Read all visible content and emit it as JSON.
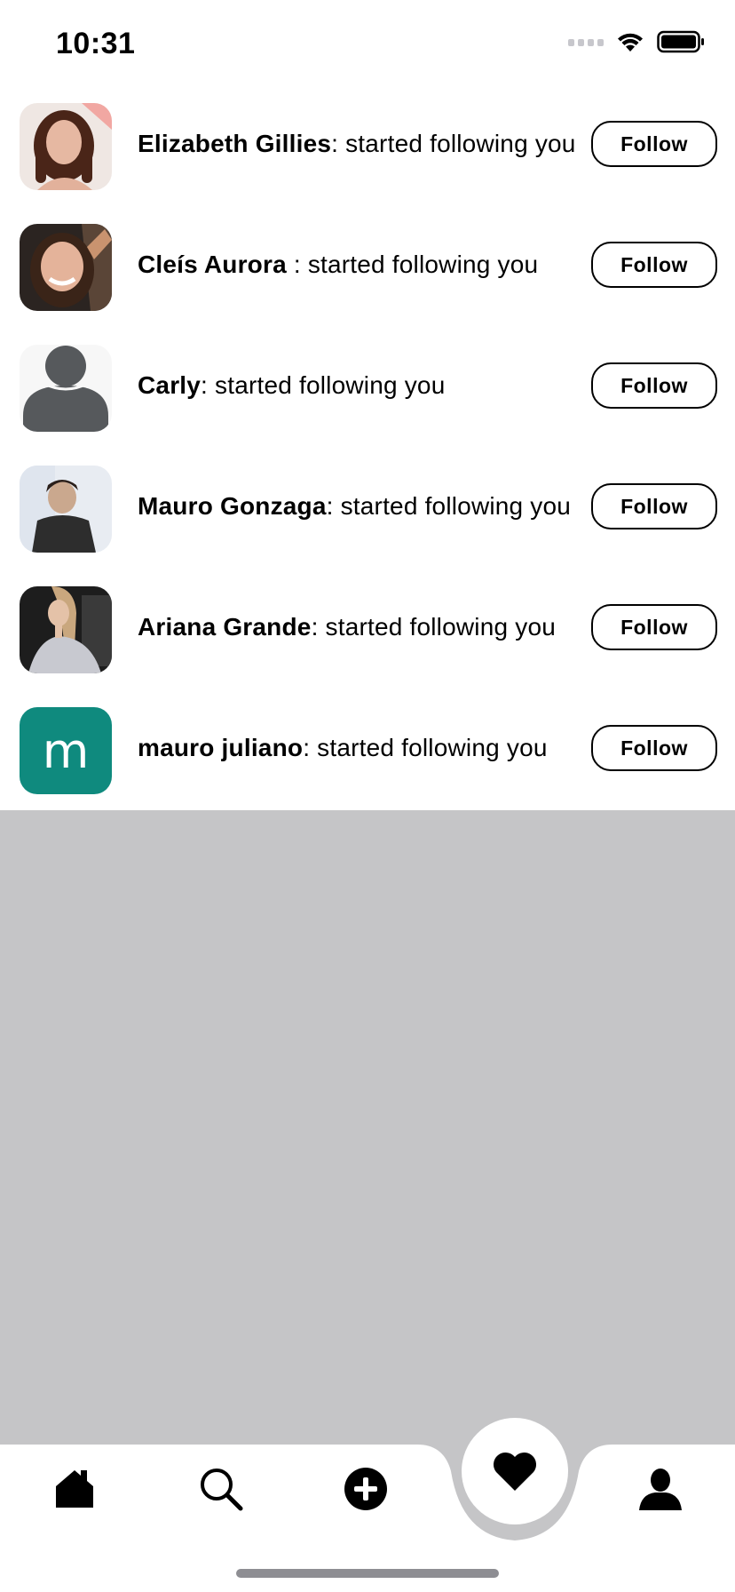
{
  "status_bar": {
    "time": "10:31"
  },
  "notifications": [
    {
      "name": "Elizabeth Gillies",
      "separator": ": ",
      "message": "started following you",
      "button_label": "Follow",
      "avatar": "photo"
    },
    {
      "name": "Cleís Aurora",
      "separator": " : ",
      "message": "started following you",
      "button_label": "Follow",
      "avatar": "photo"
    },
    {
      "name": "Carly",
      "separator": ": ",
      "message": "started following you",
      "button_label": "Follow",
      "avatar": "placeholder-person-icon"
    },
    {
      "name": "Mauro Gonzaga",
      "separator": ": ",
      "message": "started following you",
      "button_label": "Follow",
      "avatar": "photo"
    },
    {
      "name": "Ariana Grande",
      "separator": ": ",
      "message": "started following you",
      "button_label": "Follow",
      "avatar": "photo"
    },
    {
      "name": "mauro juliano",
      "separator": ": ",
      "message": "started following you",
      "button_label": "Follow",
      "avatar": "letter",
      "avatar_letter": "m",
      "avatar_color": "#0f8a7e"
    }
  ],
  "tab_bar": {
    "items": [
      {
        "icon": "home-icon",
        "active": false
      },
      {
        "icon": "search-icon",
        "active": false
      },
      {
        "icon": "add-icon",
        "active": false
      },
      {
        "icon": "heart-icon",
        "active": true
      },
      {
        "icon": "profile-icon",
        "active": false
      }
    ]
  },
  "colors": {
    "background": "#ffffff",
    "empty_area": "#c5c5c7",
    "accent_avatar": "#0f8a7e"
  }
}
